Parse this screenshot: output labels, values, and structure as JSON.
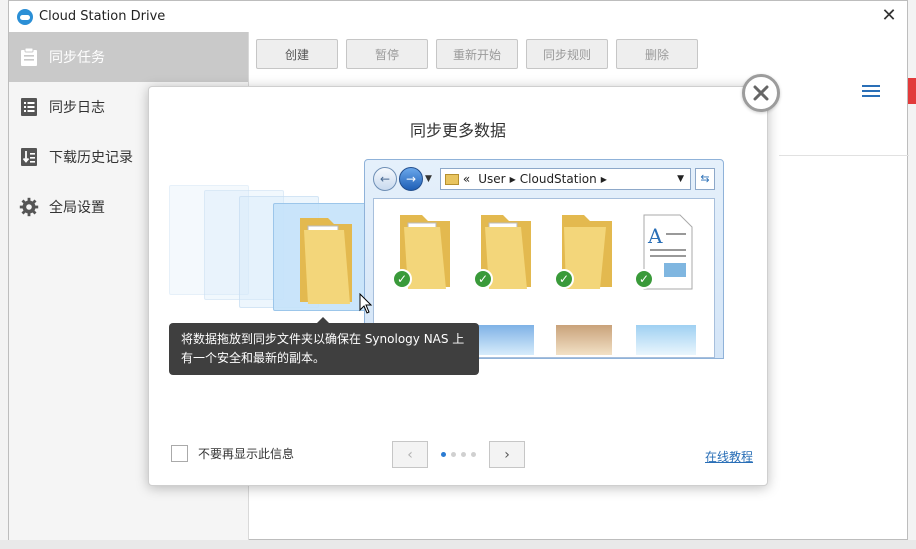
{
  "window": {
    "title": "Cloud Station Drive"
  },
  "sidebar": {
    "items": [
      {
        "label": "同步任务",
        "icon": "clipboard-icon",
        "active": true
      },
      {
        "label": "同步日志",
        "icon": "log-list-icon",
        "active": false
      },
      {
        "label": "下载历史记录",
        "icon": "download-history-icon",
        "active": false
      },
      {
        "label": "全局设置",
        "icon": "gear-icon",
        "active": false
      }
    ]
  },
  "toolbar": {
    "buttons": [
      {
        "label": "创建",
        "enabled": true
      },
      {
        "label": "暂停",
        "enabled": false
      },
      {
        "label": "重新开始",
        "enabled": false
      },
      {
        "label": "同步规则",
        "enabled": false
      },
      {
        "label": "删除",
        "enabled": false
      }
    ]
  },
  "dialog": {
    "title": "同步更多数据",
    "illustration": {
      "breadcrumb": [
        "«",
        "User",
        "CloudStation"
      ],
      "tooltip": "将数据拖放到同步文件夹以确保在 Synology NAS 上有一个安全和最新的副本。"
    },
    "dont_show_label": "不要再显示此信息",
    "pager": {
      "prev": "‹",
      "next": "›",
      "current_page": 1,
      "total_pages": 4
    },
    "online_tutorial_label": "在线教程"
  },
  "colors": {
    "accent": "#2a7bd2",
    "sidebar_active": "#c9c9c9",
    "tooltip_bg": "#3f3f3f",
    "check_green": "#3a9a3a"
  }
}
